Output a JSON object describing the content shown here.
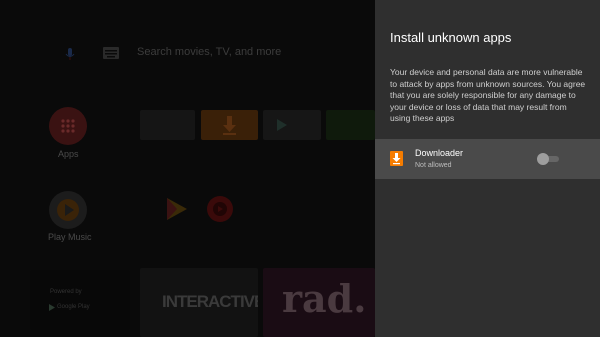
{
  "home": {
    "search_placeholder": "Search movies, TV, and more",
    "apps_label": "Apps",
    "play_music_label": "Play Music",
    "powered_by": "Powered by",
    "google_play": "Google Play",
    "tile_interactive": "INTERACTIVE",
    "tile_rad": "rad."
  },
  "panel": {
    "title": "Install unknown apps",
    "description": "Your device and personal data are more vulnerable to attack by apps from unknown sources. You agree that you are solely responsible for any damage to your device or loss of data that may result from using these apps",
    "app_item": {
      "name": "Downloader",
      "status": "Not allowed",
      "toggle_on": false
    }
  },
  "colors": {
    "panel_bg": "#2f2f2f",
    "selected_row_bg": "#4a4a4a",
    "downloader_orange": "#f57c00"
  }
}
